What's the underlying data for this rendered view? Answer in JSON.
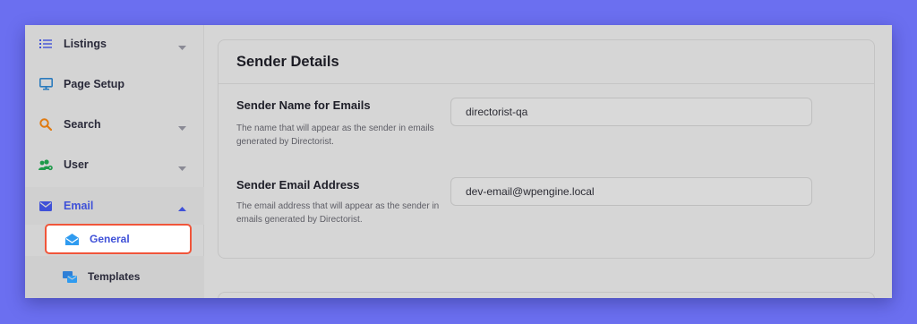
{
  "sidebar": {
    "items": [
      {
        "label": "Listings",
        "icon": "list-icon",
        "has_caret": true
      },
      {
        "label": "Page Setup",
        "icon": "monitor-icon",
        "has_caret": false
      },
      {
        "label": "Search",
        "icon": "search-icon",
        "has_caret": true
      },
      {
        "label": "User",
        "icon": "users-icon",
        "has_caret": true
      },
      {
        "label": "Email",
        "icon": "envelope-icon",
        "has_caret": true,
        "expanded": true
      }
    ],
    "email_sub": [
      {
        "label": "General",
        "icon": "open-envelope-icon",
        "selected": true
      },
      {
        "label": "Templates",
        "icon": "templates-icon",
        "selected": false
      }
    ]
  },
  "card": {
    "title": "Sender Details",
    "fields": [
      {
        "label": "Sender Name for Emails",
        "description": "The name that will appear as the sender in emails generated by Directorist.",
        "value": "directorist-qa"
      },
      {
        "label": "Sender Email Address",
        "description": "The email address that will appear as the sender in emails generated by Directorist.",
        "value": "dev-email@wpengine.local"
      }
    ]
  },
  "colors": {
    "background": "#6b6ff0",
    "accent": "#3f51d8",
    "highlight_border": "#f0553a"
  }
}
